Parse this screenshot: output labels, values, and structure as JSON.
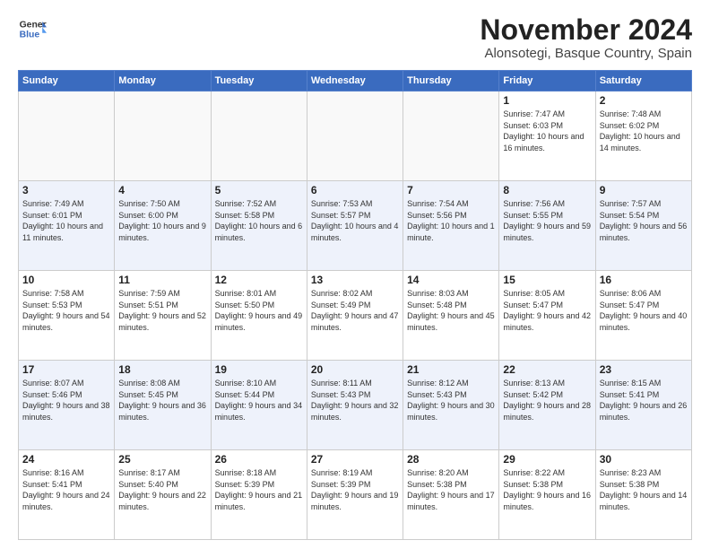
{
  "header": {
    "logo_line1": "General",
    "logo_line2": "Blue",
    "title": "November 2024",
    "subtitle": "Alonsotegi, Basque Country, Spain"
  },
  "weekdays": [
    "Sunday",
    "Monday",
    "Tuesday",
    "Wednesday",
    "Thursday",
    "Friday",
    "Saturday"
  ],
  "weeks": [
    [
      {
        "day": "",
        "info": ""
      },
      {
        "day": "",
        "info": ""
      },
      {
        "day": "",
        "info": ""
      },
      {
        "day": "",
        "info": ""
      },
      {
        "day": "",
        "info": ""
      },
      {
        "day": "1",
        "info": "Sunrise: 7:47 AM\nSunset: 6:03 PM\nDaylight: 10 hours\nand 16 minutes."
      },
      {
        "day": "2",
        "info": "Sunrise: 7:48 AM\nSunset: 6:02 PM\nDaylight: 10 hours\nand 14 minutes."
      }
    ],
    [
      {
        "day": "3",
        "info": "Sunrise: 7:49 AM\nSunset: 6:01 PM\nDaylight: 10 hours\nand 11 minutes."
      },
      {
        "day": "4",
        "info": "Sunrise: 7:50 AM\nSunset: 6:00 PM\nDaylight: 10 hours\nand 9 minutes."
      },
      {
        "day": "5",
        "info": "Sunrise: 7:52 AM\nSunset: 5:58 PM\nDaylight: 10 hours\nand 6 minutes."
      },
      {
        "day": "6",
        "info": "Sunrise: 7:53 AM\nSunset: 5:57 PM\nDaylight: 10 hours\nand 4 minutes."
      },
      {
        "day": "7",
        "info": "Sunrise: 7:54 AM\nSunset: 5:56 PM\nDaylight: 10 hours\nand 1 minute."
      },
      {
        "day": "8",
        "info": "Sunrise: 7:56 AM\nSunset: 5:55 PM\nDaylight: 9 hours\nand 59 minutes."
      },
      {
        "day": "9",
        "info": "Sunrise: 7:57 AM\nSunset: 5:54 PM\nDaylight: 9 hours\nand 56 minutes."
      }
    ],
    [
      {
        "day": "10",
        "info": "Sunrise: 7:58 AM\nSunset: 5:53 PM\nDaylight: 9 hours\nand 54 minutes."
      },
      {
        "day": "11",
        "info": "Sunrise: 7:59 AM\nSunset: 5:51 PM\nDaylight: 9 hours\nand 52 minutes."
      },
      {
        "day": "12",
        "info": "Sunrise: 8:01 AM\nSunset: 5:50 PM\nDaylight: 9 hours\nand 49 minutes."
      },
      {
        "day": "13",
        "info": "Sunrise: 8:02 AM\nSunset: 5:49 PM\nDaylight: 9 hours\nand 47 minutes."
      },
      {
        "day": "14",
        "info": "Sunrise: 8:03 AM\nSunset: 5:48 PM\nDaylight: 9 hours\nand 45 minutes."
      },
      {
        "day": "15",
        "info": "Sunrise: 8:05 AM\nSunset: 5:47 PM\nDaylight: 9 hours\nand 42 minutes."
      },
      {
        "day": "16",
        "info": "Sunrise: 8:06 AM\nSunset: 5:47 PM\nDaylight: 9 hours\nand 40 minutes."
      }
    ],
    [
      {
        "day": "17",
        "info": "Sunrise: 8:07 AM\nSunset: 5:46 PM\nDaylight: 9 hours\nand 38 minutes."
      },
      {
        "day": "18",
        "info": "Sunrise: 8:08 AM\nSunset: 5:45 PM\nDaylight: 9 hours\nand 36 minutes."
      },
      {
        "day": "19",
        "info": "Sunrise: 8:10 AM\nSunset: 5:44 PM\nDaylight: 9 hours\nand 34 minutes."
      },
      {
        "day": "20",
        "info": "Sunrise: 8:11 AM\nSunset: 5:43 PM\nDaylight: 9 hours\nand 32 minutes."
      },
      {
        "day": "21",
        "info": "Sunrise: 8:12 AM\nSunset: 5:43 PM\nDaylight: 9 hours\nand 30 minutes."
      },
      {
        "day": "22",
        "info": "Sunrise: 8:13 AM\nSunset: 5:42 PM\nDaylight: 9 hours\nand 28 minutes."
      },
      {
        "day": "23",
        "info": "Sunrise: 8:15 AM\nSunset: 5:41 PM\nDaylight: 9 hours\nand 26 minutes."
      }
    ],
    [
      {
        "day": "24",
        "info": "Sunrise: 8:16 AM\nSunset: 5:41 PM\nDaylight: 9 hours\nand 24 minutes."
      },
      {
        "day": "25",
        "info": "Sunrise: 8:17 AM\nSunset: 5:40 PM\nDaylight: 9 hours\nand 22 minutes."
      },
      {
        "day": "26",
        "info": "Sunrise: 8:18 AM\nSunset: 5:39 PM\nDaylight: 9 hours\nand 21 minutes."
      },
      {
        "day": "27",
        "info": "Sunrise: 8:19 AM\nSunset: 5:39 PM\nDaylight: 9 hours\nand 19 minutes."
      },
      {
        "day": "28",
        "info": "Sunrise: 8:20 AM\nSunset: 5:38 PM\nDaylight: 9 hours\nand 17 minutes."
      },
      {
        "day": "29",
        "info": "Sunrise: 8:22 AM\nSunset: 5:38 PM\nDaylight: 9 hours\nand 16 minutes."
      },
      {
        "day": "30",
        "info": "Sunrise: 8:23 AM\nSunset: 5:38 PM\nDaylight: 9 hours\nand 14 minutes."
      }
    ]
  ]
}
